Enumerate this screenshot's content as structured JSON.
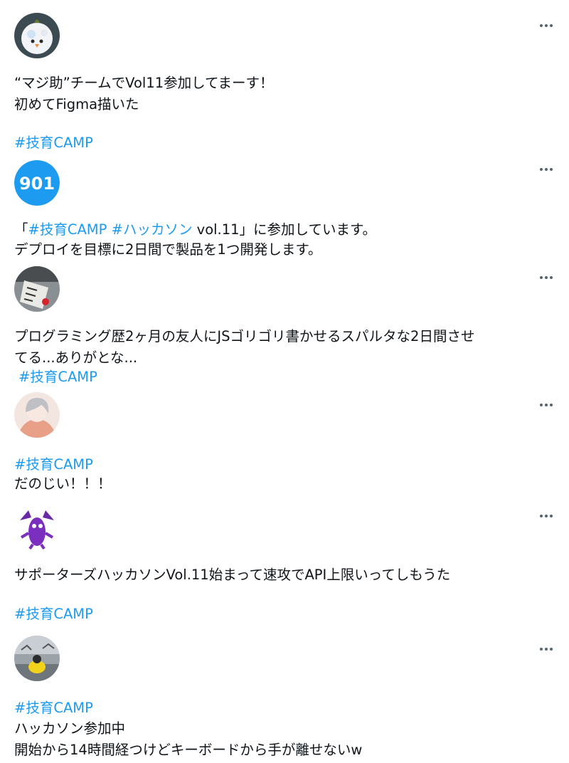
{
  "posts": [
    {
      "lines": [
        "“マジ助”チームでVol11参加してまーす！",
        "初めてFigma描いた"
      ],
      "hashtag": "#技育CAMP"
    },
    {
      "line1_before": "「",
      "line1_tag1": "#技育CAMP",
      "line1_tag2": "#ハッカソン",
      "line1_after": " vol.11」に参加しています。",
      "line2": "デプロイを目標に2日間で製品を1つ開発します。"
    },
    {
      "lines": [
        "プログラミング歴2ヶ月の友人にJSゴリゴリ書かせるスパルタな2日間させ",
        "てる...ありがとな..."
      ],
      "hashtag": "#技育CAMP"
    },
    {
      "hashtag": "#技育CAMP",
      "lines": [
        "だのじい！！！"
      ]
    },
    {
      "lines": [
        "サポーターズハッカソンVol.11始まって速攻でAPI上限いってしもうた"
      ],
      "hashtag": "#技育CAMP"
    },
    {
      "hashtag": "#技育CAMP",
      "lines": [
        "ハッカソン参加中",
        "開始から14時間経つけどキーボードから手が離せないw"
      ]
    }
  ],
  "avatars": [
    {
      "icon": "knitted-bird-avatar"
    },
    {
      "icon": "gdev-logo-avatar",
      "color": "#1d9bf0",
      "logo_text": "901"
    },
    {
      "icon": "photo-avatar"
    },
    {
      "icon": "anime-character-avatar"
    },
    {
      "icon": "purple-monster-avatar",
      "color": "#7b2fbe"
    },
    {
      "icon": "yellow-figure-avatar"
    }
  ],
  "colors": {
    "link": "#1d9bf0",
    "text": "#0f1419",
    "more_icon": "#536471"
  }
}
